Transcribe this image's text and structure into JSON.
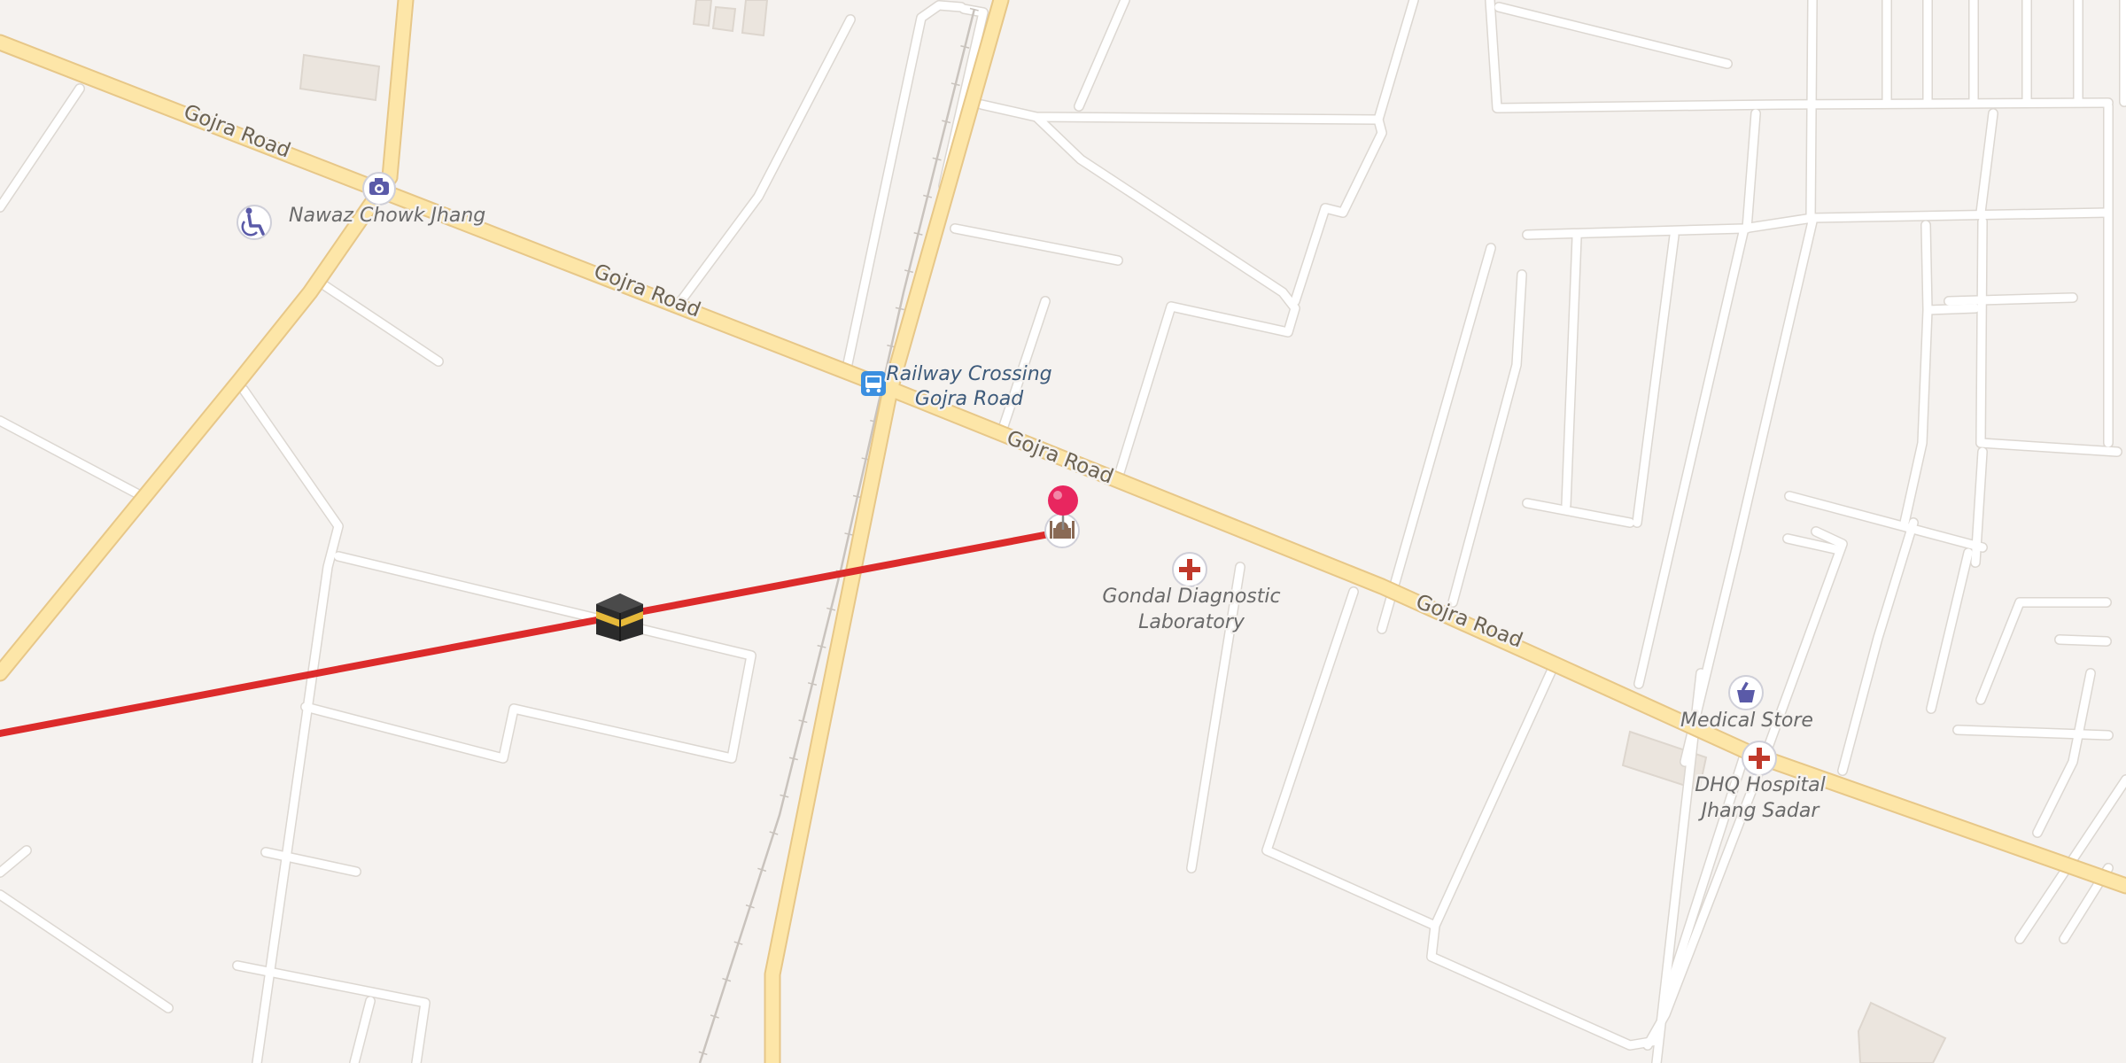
{
  "map": {
    "colors": {
      "background": "#f5f2ef",
      "minor_road": "#ffffff",
      "main_road": "#fde6a8",
      "main_road_casing": "#e7c788",
      "route_line": "#dc2b2b",
      "pin": "#e8265f",
      "poi_icon": "#5a5aa8",
      "medical_icon": "#c0392b",
      "bus_stop_icon": "#3b8fe0"
    },
    "road_labels": {
      "gojra_1": "Gojra Road",
      "gojra_2": "Gojra Road",
      "gojra_3": "Gojra Road",
      "gojra_4": "Gojra Road"
    },
    "pois": {
      "nawaz_chowk": {
        "name": "Nawaz Chowk Jhang",
        "icon": "camera-icon"
      },
      "railway_crossing": {
        "line1": "Railway Crossing",
        "line2": "Gojra Road",
        "icon": "bus-stop-icon"
      },
      "gondal_lab": {
        "line1": "Gondal Diagnostic",
        "line2": "Laboratory",
        "icon": "medical-cross-icon"
      },
      "medical_store": {
        "name": "Medical Store",
        "icon": "pharmacy-icon"
      },
      "dhq_hospital": {
        "line1": "DHQ Hospital",
        "line2": "Jhang Sadar",
        "icon": "medical-cross-icon"
      },
      "wheelchair": {
        "icon": "wheelchair-icon"
      },
      "mosque": {
        "icon": "mosque-icon"
      },
      "kaaba": {
        "icon": "kaaba-icon"
      }
    },
    "markers": {
      "location_pin": {
        "icon": "location-pin-icon"
      },
      "qibla_line": {
        "icon": "qibla-direction-line"
      }
    }
  }
}
